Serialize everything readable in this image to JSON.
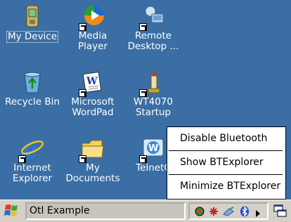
{
  "desktop": {
    "icons": [
      {
        "label": "My Device",
        "icon": "pda-icon"
      },
      {
        "label": "Media\nPlayer",
        "icon": "media-player-icon"
      },
      {
        "label": "Remote\nDesktop ...",
        "icon": "remote-desktop-icon"
      },
      {
        "label": "Recycle Bin",
        "icon": "recycle-bin-icon"
      },
      {
        "label": "Microsoft\nWordPad",
        "icon": "wordpad-icon"
      },
      {
        "label": "WT4070\nStartup",
        "icon": "startup-icon"
      },
      {
        "label": "Internet\nExplorer",
        "icon": "internet-explorer-icon"
      },
      {
        "label": "My\nDocuments",
        "icon": "folder-icon"
      },
      {
        "label": "TelnetC",
        "icon": "telnet-icon"
      }
    ]
  },
  "context_menu": {
    "items": [
      "Disable Bluetooth",
      "Show BTExplorer",
      "Minimize BTExplorer"
    ]
  },
  "taskbar": {
    "active_window": "Otl Example",
    "tray_icons": [
      "network-icon",
      "usb-icon",
      "connection-icon",
      "bluetooth-icon",
      "arrow-right-icon"
    ],
    "show_desktop_icon": "desktop-icon"
  },
  "colors": {
    "desktop": "#3a6ea5",
    "taskbar": "#d4d0c8"
  }
}
